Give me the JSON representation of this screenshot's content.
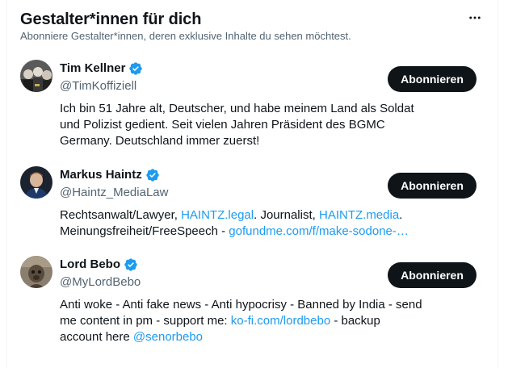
{
  "header": {
    "title": "Gestalter*innen für dich",
    "subtitle": "Abonniere Gestalter*innen, deren exklusive Inhalte du sehen möchtest.",
    "more_icon": "more-horizontal-icon"
  },
  "colors": {
    "text": "#0f1419",
    "secondary": "#536471",
    "link": "#1d9bf0",
    "button_bg": "#0f1419",
    "verified": "#1d9bf0"
  },
  "creators": [
    {
      "name": "Tim Kellner",
      "handle": "@TimKoffiziell",
      "bio": "Ich bin 51 Jahre alt, Deutscher, und habe meinem Land als Soldat und Polizist gedient. Seit vielen Jahren Präsident des BGMC Germany. Deutschland immer zuerst!",
      "button": "Abonnieren"
    },
    {
      "name": "Markus Haintz",
      "handle": "@Haintz_MediaLaw",
      "bio_parts": [
        "Rechtsanwalt/Lawyer, ",
        "HAINTZ.legal",
        ". Journalist, ",
        "HAINTZ.media",
        ". Meinungsfreiheit/FreeSpeech - ",
        "gofundme.com/f/make-sodone-…"
      ],
      "button": "Abonnieren"
    },
    {
      "name": "Lord Bebo",
      "handle": "@MyLordBebo",
      "bio_parts": [
        "Anti woke - Anti fake news - Anti hypocrisy - Banned by India - send me content in pm - support me: ",
        "ko-fi.com/lordbebo",
        " - backup account here ",
        "@senorbebo"
      ],
      "button": "Abonnieren"
    }
  ]
}
